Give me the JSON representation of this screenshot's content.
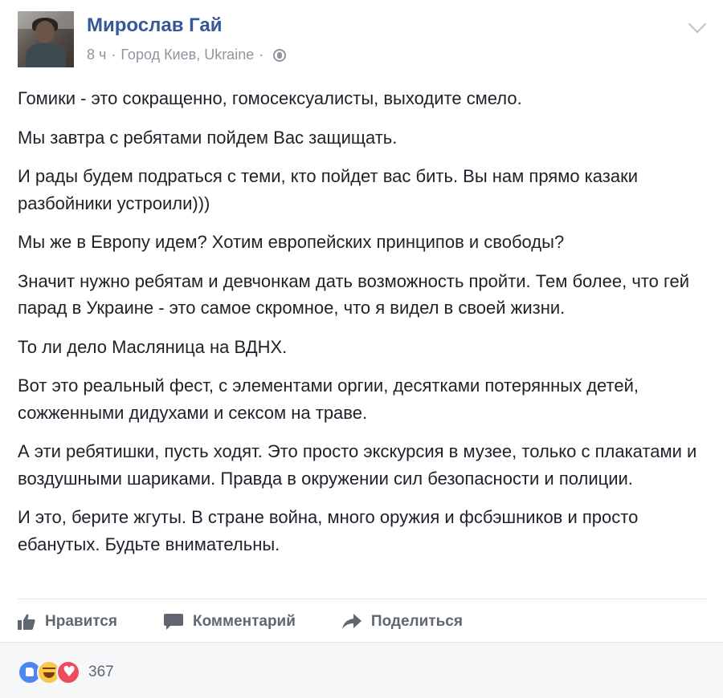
{
  "post": {
    "author": "Мирослав Гай",
    "time": "8 ч",
    "location": "Город Киев, Ukraine",
    "separator": "·",
    "paragraphs": [
      "Гомики - это сокращенно, гомосексуалисты, выходите смело.",
      "Мы завтра с ребятами пойдем Вас защищать.",
      "И рады будем подраться с теми, кто пойдет вас бить. Вы нам прямо казаки разбойники устроили)))",
      "Мы же в Европу идем? Хотим европейских принципов и свободы?",
      "Значит нужно ребятам и девчонкам дать возможность пройти. Тем более, что гей парад в Украине - это самое скромное, что я видел в своей жизни.",
      "То ли дело Масляница на ВДНХ.",
      "Вот это реальный фест, с элементами оргии, десятками потерянных детей, сожженными дидухами и сексом на траве.",
      "А эти ребятишки, пусть ходят. Это просто экскурсия в музее, только с плакатами и воздушными шариками. Правда в окружении сил безопасности и полиции.",
      "И это, берите жгуты. В стране война, много оружия и фсбэшников и просто ебанутых. Будьте внимательны."
    ]
  },
  "actions": {
    "like": "Нравится",
    "comment": "Комментарий",
    "share": "Поделиться"
  },
  "reactions": {
    "types": [
      "like",
      "haha",
      "love"
    ],
    "count": "367"
  },
  "icons": {
    "privacy": "globe-icon",
    "menu": "chevron-down-icon",
    "like": "thumbs-up-icon",
    "comment": "comment-icon",
    "share": "share-arrow-icon"
  },
  "colors": {
    "author": "#365899",
    "meta": "#90949c",
    "action": "#606770",
    "like_reaction": "#4d86f0",
    "love_reaction": "#ed4c5c",
    "haha_reaction": "#f7c948"
  }
}
